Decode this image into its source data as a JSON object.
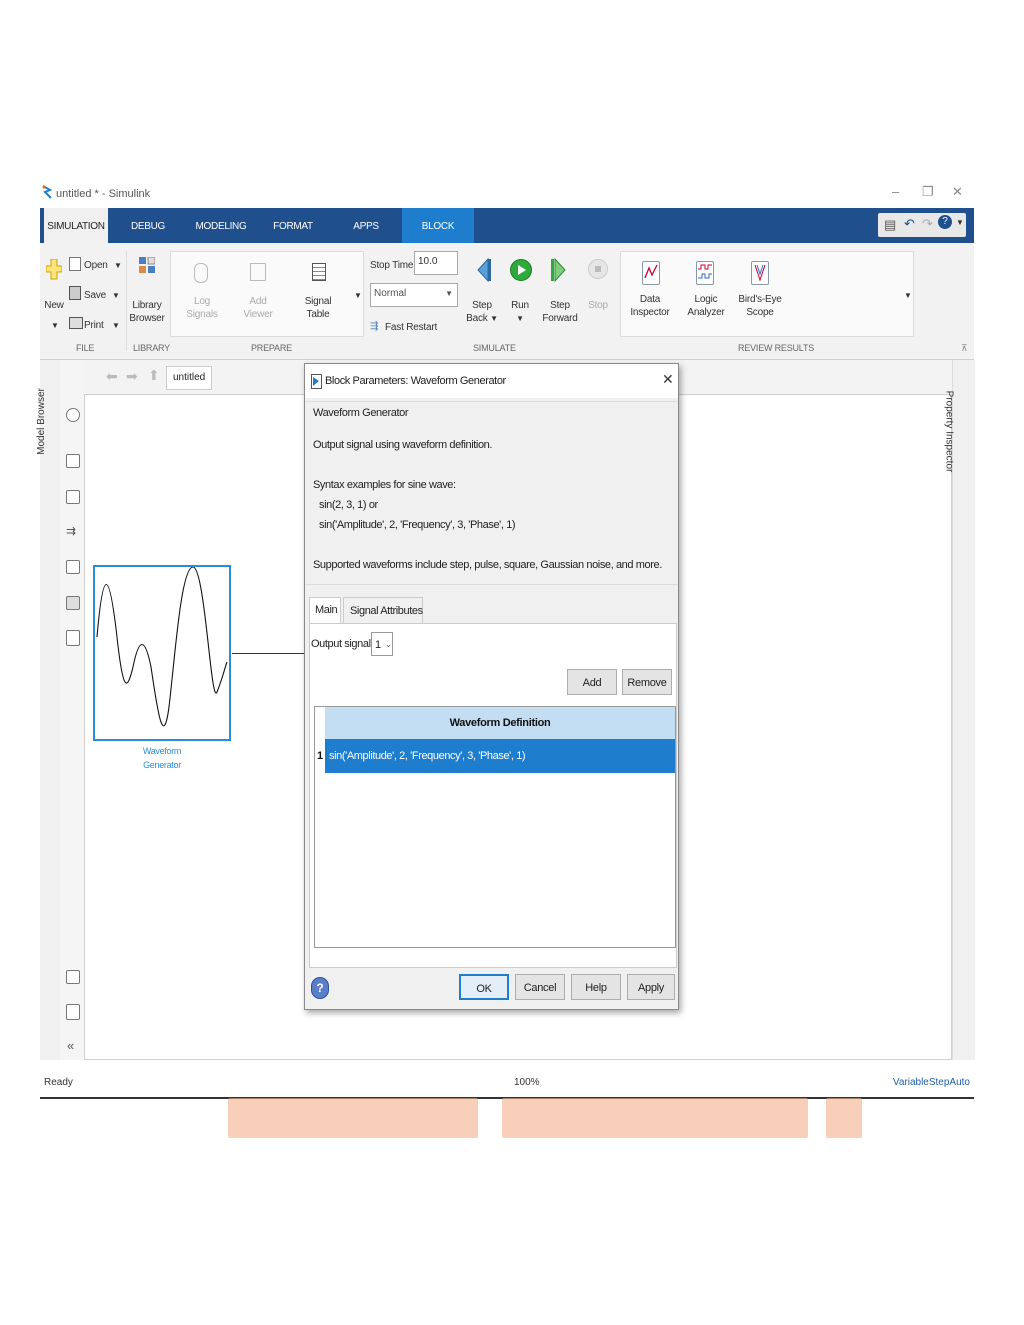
{
  "window": {
    "title": "untitled * - Simulink"
  },
  "ribbon_tabs": [
    "SIMULATION",
    "DEBUG",
    "MODELING",
    "FORMAT",
    "APPS",
    "BLOCK"
  ],
  "toolstrip": {
    "file": {
      "new": "New",
      "open": "Open",
      "save": "Save",
      "print": "Print",
      "label": "FILE"
    },
    "library": {
      "line1": "Library",
      "line2": "Browser",
      "label": "LIBRARY"
    },
    "prepare": {
      "log1": "Log",
      "log2": "Signals",
      "add1": "Add",
      "add2": "Viewer",
      "sig1": "Signal",
      "sig2": "Table",
      "label": "PREPARE"
    },
    "simulate": {
      "stop_time_label": "Stop Time",
      "stop_time_value": "10.0",
      "mode": "Normal",
      "fast_restart": "Fast Restart",
      "stepback1": "Step",
      "stepback2": "Back",
      "run": "Run",
      "stepfwd1": "Step",
      "stepfwd2": "Forward",
      "stop": "Stop",
      "label": "SIMULATE"
    },
    "review": {
      "di1": "Data",
      "di2": "Inspector",
      "la1": "Logic",
      "la2": "Analyzer",
      "be1": "Bird's-Eye",
      "be2": "Scope",
      "label": "REVIEW RESULTS"
    }
  },
  "side": {
    "model_browser": "Model Browser",
    "property_inspector": "Property Inspector"
  },
  "nav": {
    "breadcrumb": "untitled"
  },
  "block": {
    "line1": "Waveform",
    "line2": "Generator"
  },
  "dialog": {
    "title": "Block Parameters: Waveform Generator",
    "heading": "Waveform Generator",
    "description": "Output signal using waveform definition.",
    "syntax_title": "Syntax examples for sine wave:",
    "syntax1": "sin(2, 3, 1) or",
    "syntax2": "sin('Amplitude', 2, 'Frequency', 3, 'Phase', 1)",
    "supported": "Supported waveforms include step, pulse, square, Gaussian noise, and more.",
    "tab_main": "Main",
    "tab_signal": "Signal Attributes",
    "output_label": "Output signal:",
    "output_value": "1",
    "add": "Add",
    "remove": "Remove",
    "table_header": "Waveform Definition",
    "rows": [
      {
        "num": "1",
        "value": "sin('Amplitude', 2, 'Frequency', 3, 'Phase', 1)"
      }
    ],
    "ok": "OK",
    "cancel": "Cancel",
    "help": "Help",
    "apply": "Apply"
  },
  "status": {
    "left": "Ready",
    "zoom": "100%",
    "solver": "VariableStepAuto"
  },
  "colors": {
    "ribbon": "#1f4f8c",
    "block_tab": "#1e7dcc",
    "selection": "#1e7dcc",
    "table_header": "#c3ddf3"
  }
}
